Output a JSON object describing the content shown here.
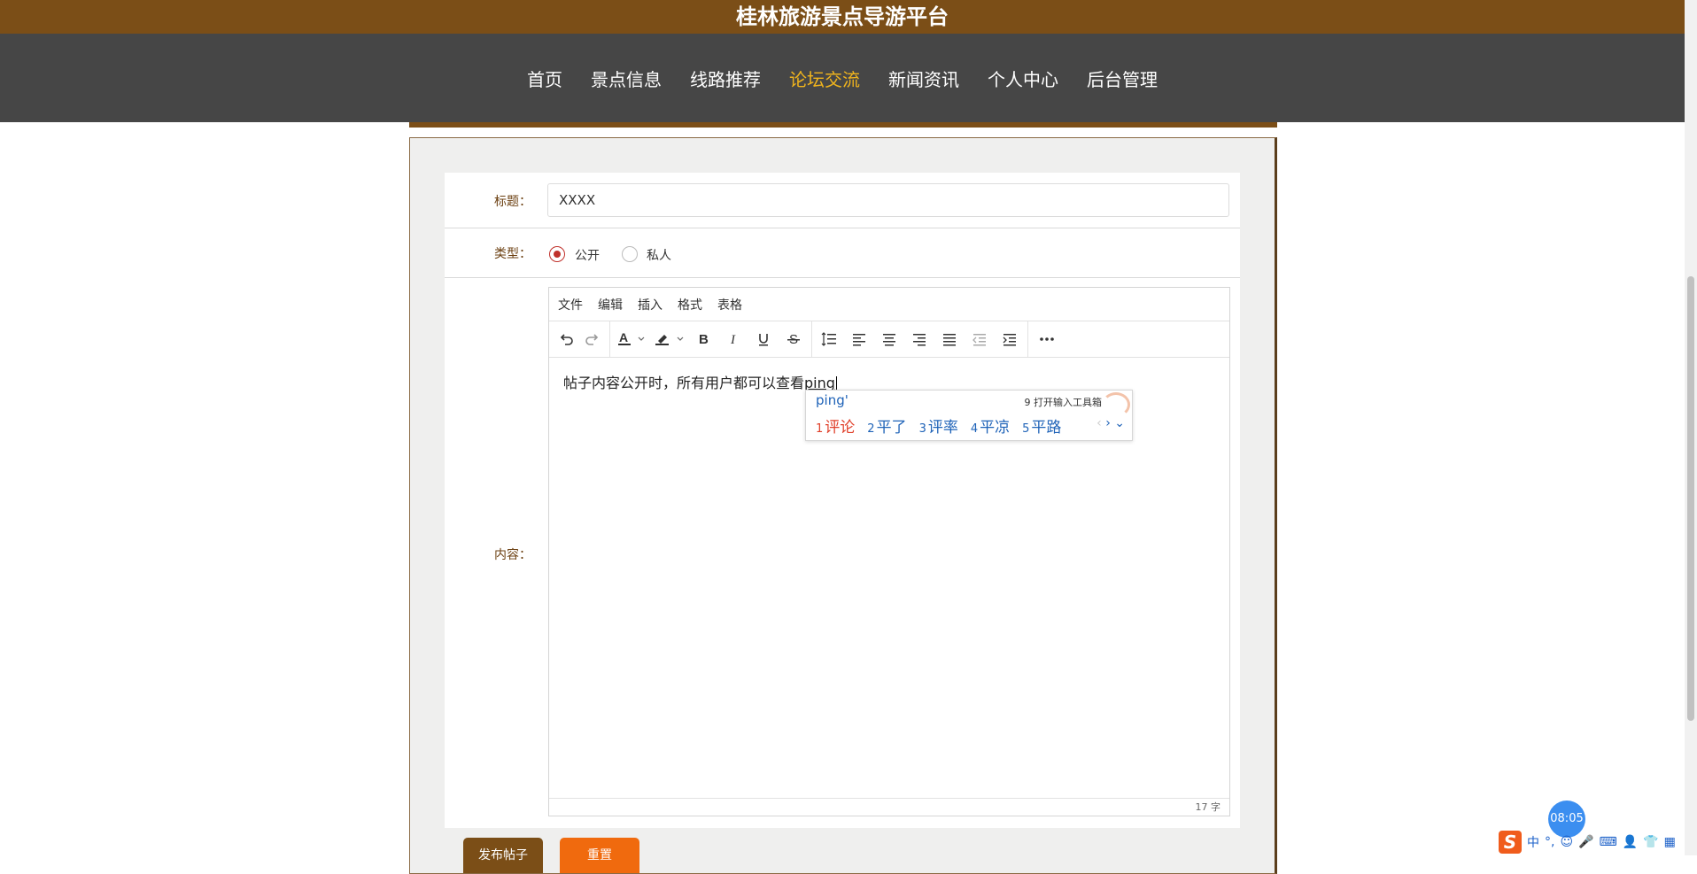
{
  "header": {
    "title": "桂林旅游景点导游平台"
  },
  "nav": {
    "items": [
      {
        "label": "首页",
        "active": false
      },
      {
        "label": "景点信息",
        "active": false
      },
      {
        "label": "线路推荐",
        "active": false
      },
      {
        "label": "论坛交流",
        "active": true
      },
      {
        "label": "新闻资讯",
        "active": false
      },
      {
        "label": "个人中心",
        "active": false
      },
      {
        "label": "后台管理",
        "active": false
      }
    ]
  },
  "form": {
    "title_label": "标题：",
    "title_value": "XXXX",
    "type_label": "类型：",
    "type_options": [
      {
        "label": "公开",
        "selected": true
      },
      {
        "label": "私人",
        "selected": false
      }
    ],
    "content_label": "内容："
  },
  "editor": {
    "menu": [
      "文件",
      "编辑",
      "插入",
      "格式",
      "表格"
    ],
    "toolbar_icons": [
      "undo-icon",
      "redo-icon",
      "text-color-icon",
      "highlight-color-icon",
      "bold-icon",
      "italic-icon",
      "underline-icon",
      "strikethrough-icon",
      "line-height-icon",
      "align-left-icon",
      "align-center-icon",
      "align-right-icon",
      "align-justify-icon",
      "outdent-icon",
      "indent-icon",
      "more-icon"
    ],
    "content_text": "帖子内容公开时，所有用户都可以查看",
    "composing_text": "ping",
    "word_count": "17 字"
  },
  "ime": {
    "code": "ping'",
    "tool_hint": "9 打开输入工具箱",
    "candidates": [
      {
        "num": "1",
        "text": "评论"
      },
      {
        "num": "2",
        "text": "平了"
      },
      {
        "num": "3",
        "text": "评率"
      },
      {
        "num": "4",
        "text": "平凉"
      },
      {
        "num": "5",
        "text": "平路"
      }
    ]
  },
  "buttons": {
    "submit": "发布帖子",
    "reset": "重置"
  },
  "colors": {
    "brand_brown": "#7b4e17",
    "nav_bg": "#464646",
    "nav_active": "#f0b41d",
    "reset_orange": "#f06a0e",
    "radio_red": "#c0312b"
  },
  "tray": {
    "clock": "08:05",
    "ime_mode": "中"
  }
}
